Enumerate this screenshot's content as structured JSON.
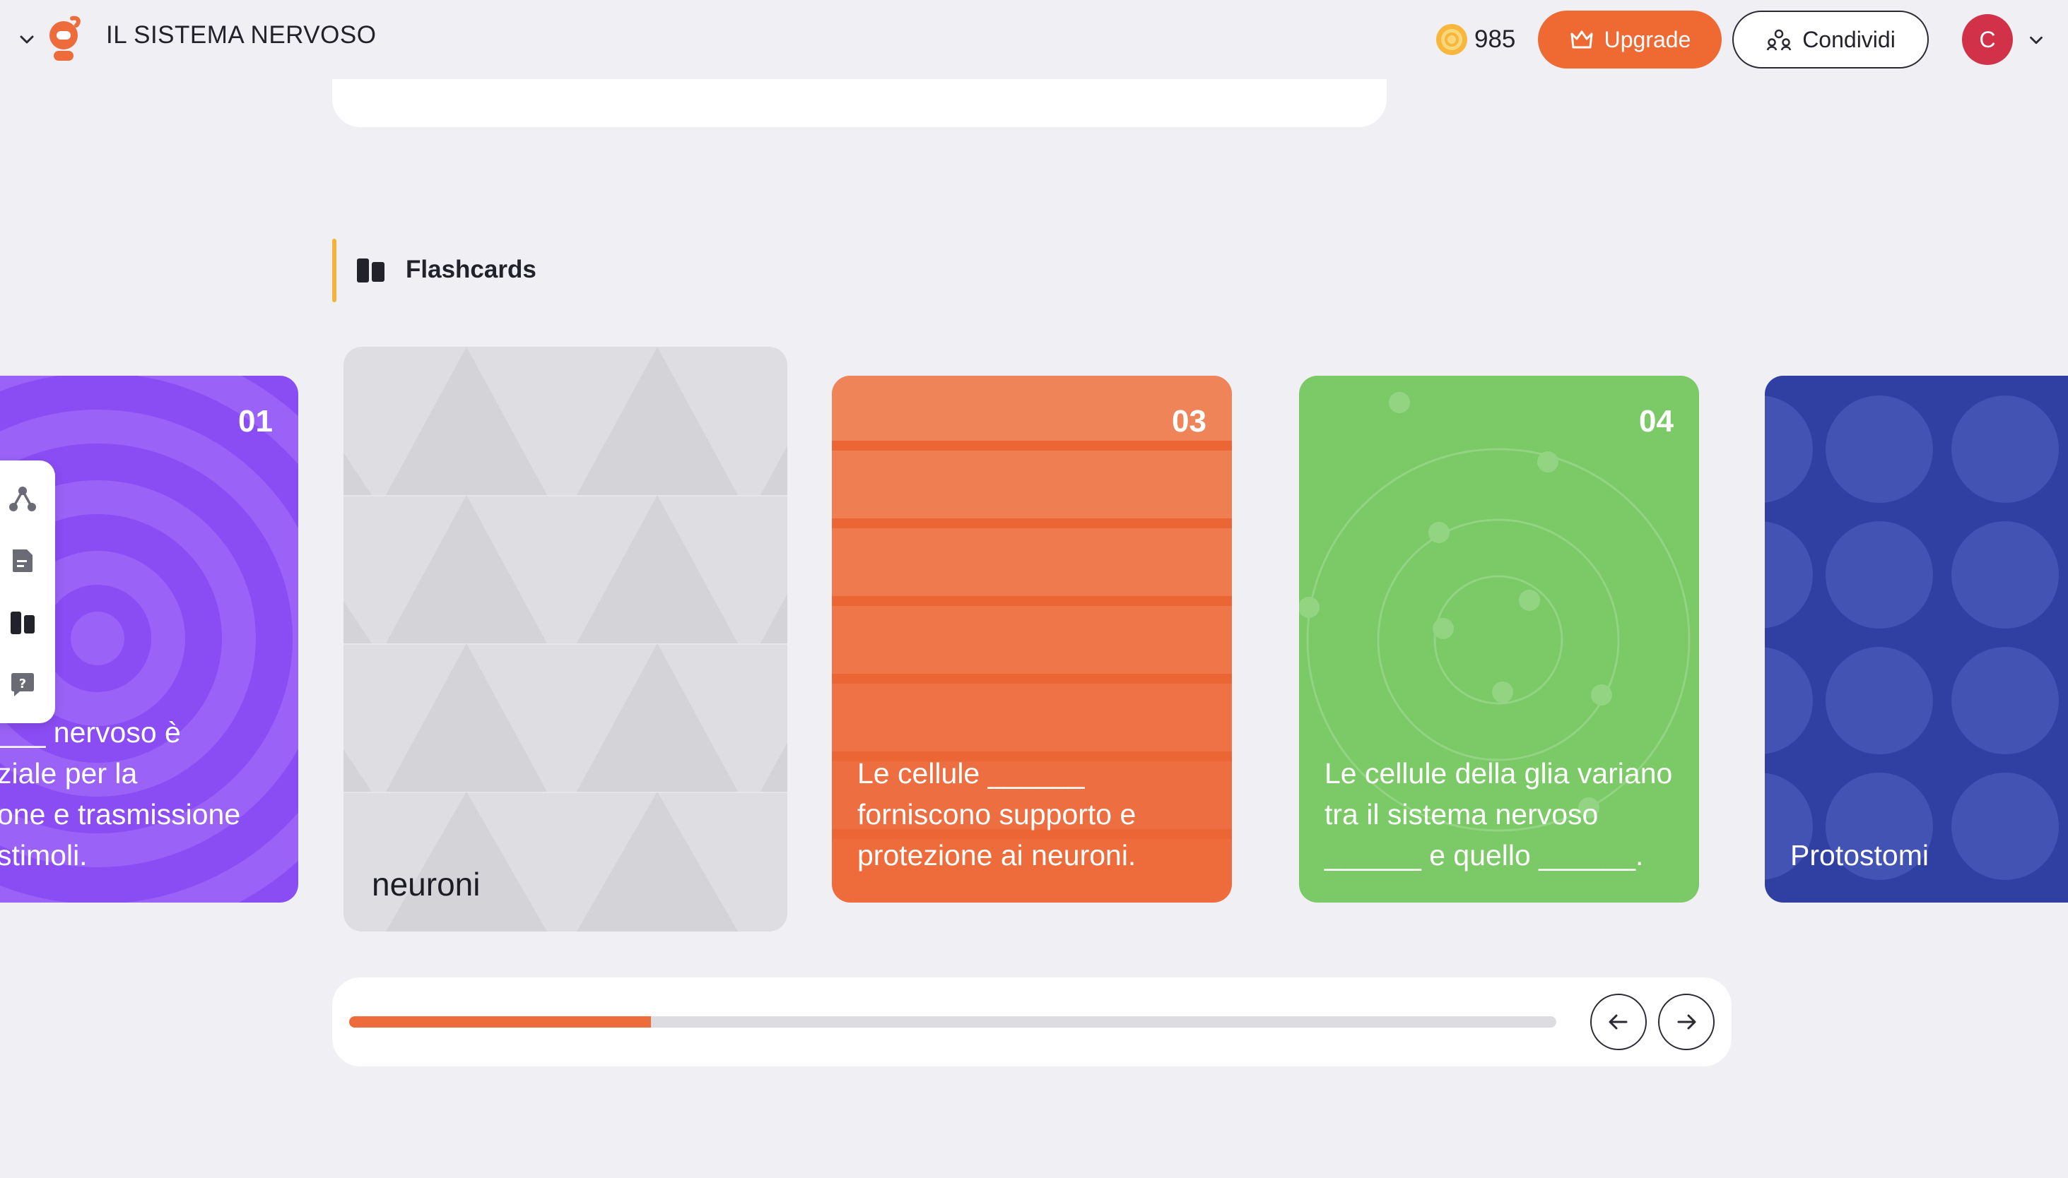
{
  "header": {
    "title": "IL SISTEMA NERVOSO",
    "coins": "985",
    "upgrade_label": "Upgrade",
    "share_label": "Condividi",
    "avatar_initial": "C"
  },
  "section": {
    "title": "Flashcards"
  },
  "flashcards": [
    {
      "number": "01",
      "lines": [
        "___ nervoso è",
        "ziale per la",
        "one e trasmissione",
        "stimoli."
      ],
      "color": "#8a4cf3"
    },
    {
      "number": "",
      "text": "neuroni",
      "color": "#dddde2"
    },
    {
      "number": "03",
      "text": "Le cellule ______ forniscono supporto e protezione ai neuroni.",
      "color": "#ee6c3c"
    },
    {
      "number": "04",
      "text": "Le cellule della glia variano tra il sistema nervoso ______ e quello ______.",
      "color": "#7bc967"
    },
    {
      "number": "",
      "text": "Protostomi",
      "color": "#2f3fa2"
    }
  ],
  "progress": {
    "fraction": 0.25
  },
  "icons": {
    "collapse": "chevron-down-icon",
    "logo": "app-logo",
    "coin": "coin-icon",
    "upgrade": "crown-icon",
    "share": "share-icon",
    "section": "flashcards-icon",
    "side": [
      "mindmap-icon",
      "notes-icon",
      "flashcards-icon",
      "quiz-icon"
    ],
    "prev": "arrow-left-icon",
    "next": "arrow-right-icon"
  }
}
